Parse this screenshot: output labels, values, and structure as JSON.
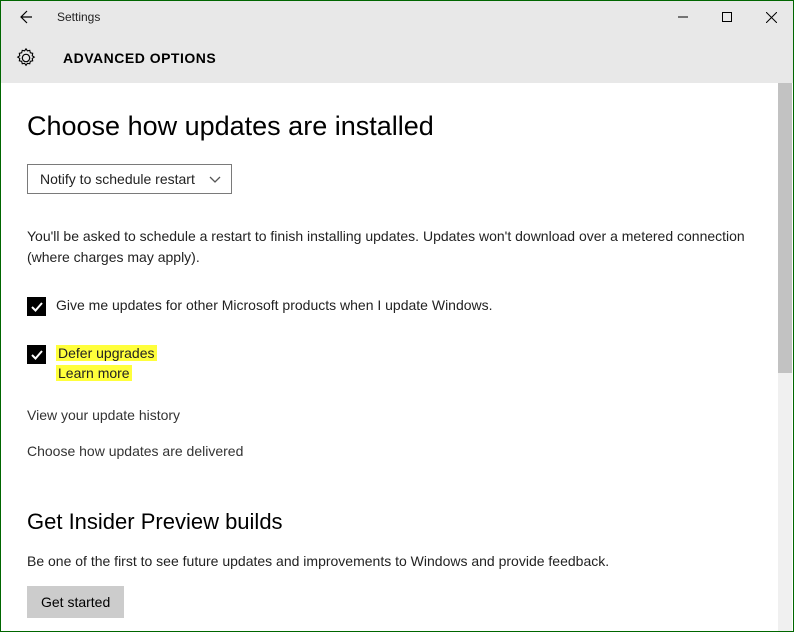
{
  "titlebar": {
    "title": "Settings"
  },
  "header": {
    "title": "ADVANCED OPTIONS"
  },
  "main": {
    "heading": "Choose how updates are installed",
    "dropdown_value": "Notify to schedule restart",
    "description": "You'll be asked to schedule a restart to finish installing updates. Updates won't download over a metered connection (where charges may apply).",
    "checkbox1": {
      "checked": true,
      "label": "Give me updates for other Microsoft products when I update Windows."
    },
    "checkbox2": {
      "checked": true,
      "label": "Defer upgrades",
      "learn_more": "Learn more"
    },
    "link1": "View your update history",
    "link2": "Choose how updates are delivered",
    "insider": {
      "heading": "Get Insider Preview builds",
      "text": "Be one of the first to see future updates and improvements to Windows and provide feedback.",
      "button": "Get started"
    }
  }
}
